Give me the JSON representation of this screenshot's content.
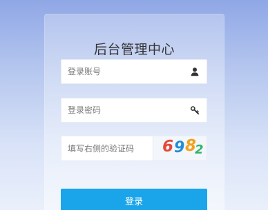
{
  "title": "后台管理中心",
  "form": {
    "account_placeholder": "登录账号",
    "password_placeholder": "登录密码",
    "captcha_placeholder": "填写右侧的验证码",
    "captcha_code": [
      "6",
      "9",
      "8",
      "2"
    ],
    "submit_label": "登录"
  },
  "icons": {
    "account": "user-icon",
    "password": "key-icon"
  },
  "colors": {
    "button": "#1aa5ea",
    "title": "#333333",
    "captcha_digits": [
      "#e54a3a",
      "#1f8fd6",
      "#f3a21a",
      "#2fb36b"
    ]
  }
}
